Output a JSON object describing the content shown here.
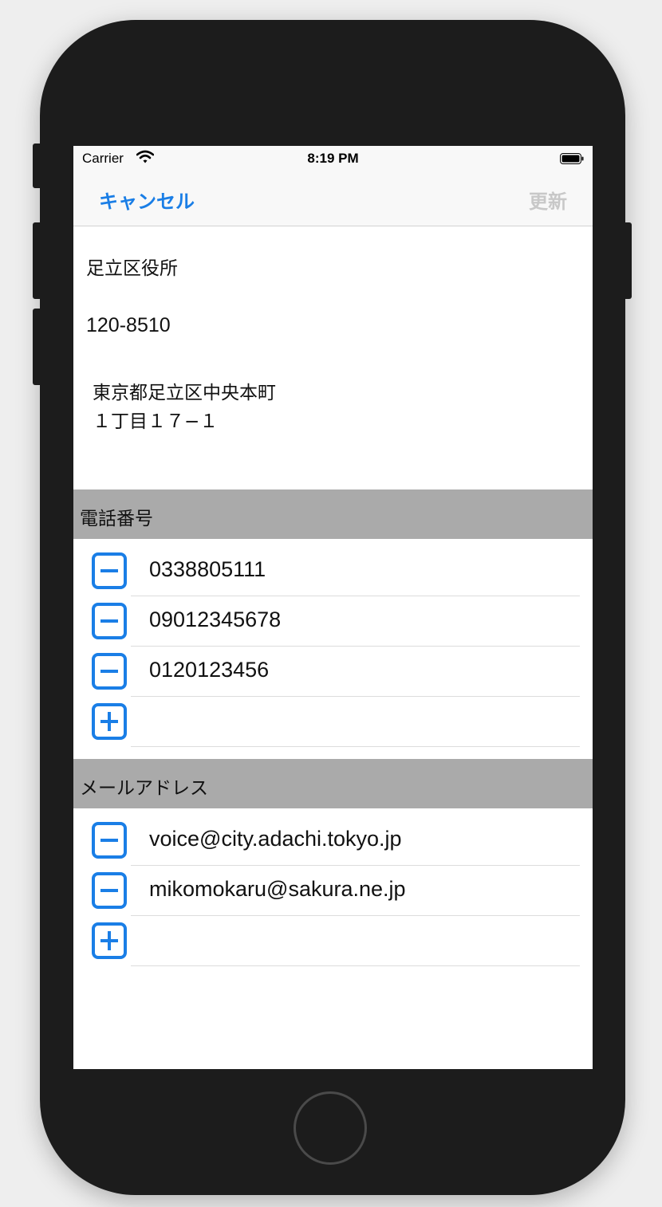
{
  "statusbar": {
    "carrier": "Carrier",
    "time": "8:19 PM"
  },
  "navbar": {
    "cancel_label": "キャンセル",
    "update_label": "更新"
  },
  "form": {
    "name": "足立区役所",
    "postal_code": "120-8510",
    "address_line1": "東京都足立区中央本町",
    "address_line2": "１丁目１７−１"
  },
  "phone_section": {
    "header": "電話番号",
    "items": [
      "0338805111",
      "09012345678",
      "0120123456"
    ]
  },
  "email_section": {
    "header": "メールアドレス",
    "items": [
      "voice@city.adachi.tokyo.jp",
      "mikomokaru@sakura.ne.jp"
    ]
  },
  "colors": {
    "accent": "#1a7ee6",
    "section_header_bg": "#aaaaaa",
    "disabled": "#c8c8c8"
  },
  "icons": {
    "remove": "minus-box-icon",
    "add": "plus-box-icon",
    "wifi": "wifi-icon",
    "battery": "battery-icon"
  }
}
